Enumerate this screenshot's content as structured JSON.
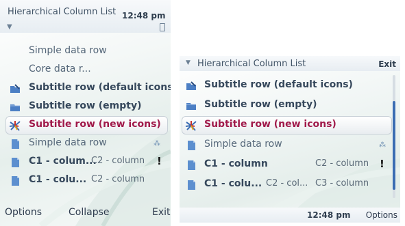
{
  "portrait": {
    "title": "Hierarchical Column List",
    "time": "12:48 pm",
    "rows": {
      "r1": "Simple data row",
      "r2": "Core data r...",
      "r3": "Subtitle row (default icons)",
      "r4": "Subtitle row (empty)",
      "r5": "Subtitle row (new icons)",
      "r6": "Simple data row",
      "r7c1": "C1 - colum...",
      "r7c2": "C2 - column",
      "r7flag": "!",
      "r8c1": "C1 - colu...",
      "r8c2": "C2 - column"
    },
    "softkeys": {
      "left": "Options",
      "middle": "Collapse",
      "right": "Exit"
    }
  },
  "landscape": {
    "title": "Hierarchical Column List",
    "exit": "Exit",
    "rows": {
      "r1": "Subtitle row (default icons)",
      "r2": "Subtitle row (empty)",
      "r3": "Subtitle row (new icons)",
      "r4": "Simple data row",
      "r5c1": "C1 - column",
      "r5c2": "C2 - column",
      "r5flag": "!",
      "r6c1": "C1 - colu...",
      "r6c2": "C2 - col...",
      "r6c3": "C3 - column"
    },
    "time": "12:48 pm",
    "softkey_right": "Options"
  },
  "colors": {
    "highlight_text": "#a0194a",
    "accent": "#3b6db3"
  }
}
